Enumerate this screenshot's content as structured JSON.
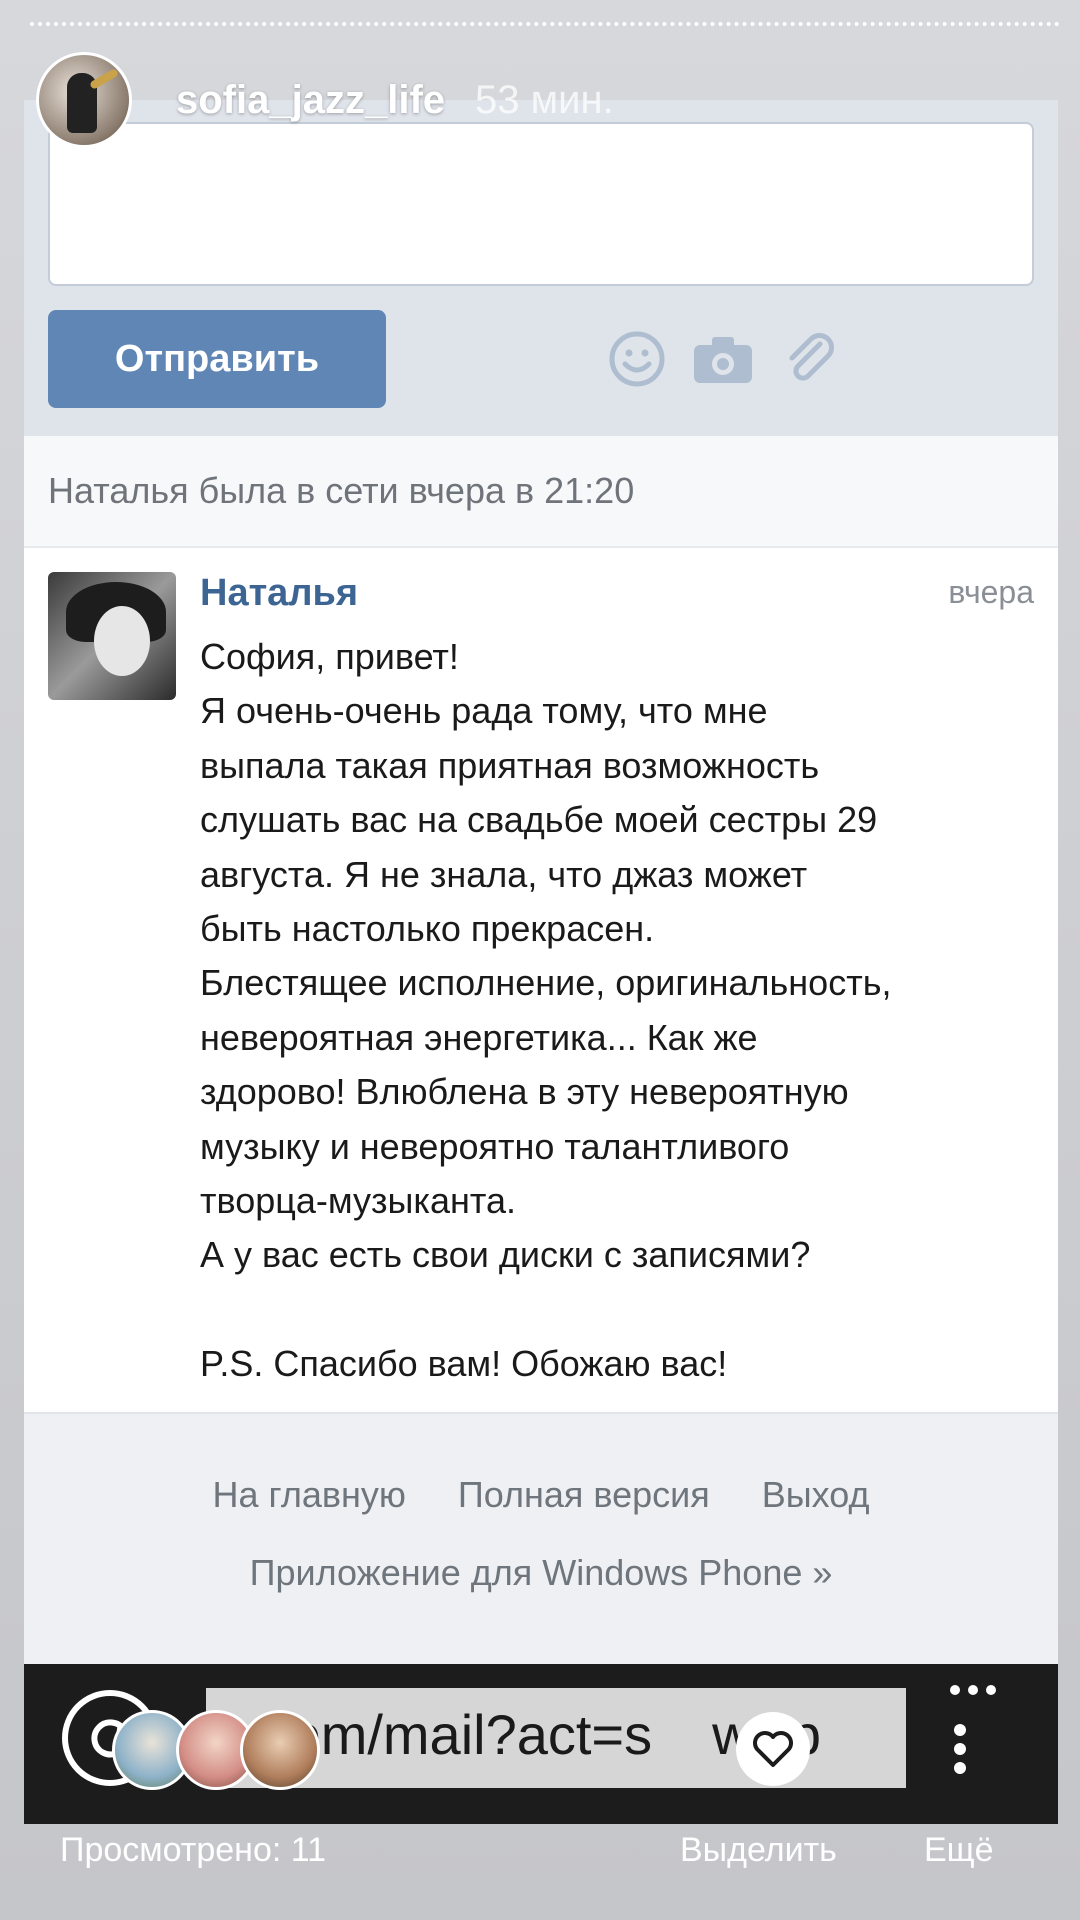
{
  "story": {
    "username": "sofia_jazz_life",
    "time_ago": "53 мин."
  },
  "compose": {
    "send_label": "Отправить",
    "icons": [
      "smile-icon",
      "camera-icon",
      "paperclip-icon"
    ]
  },
  "status": {
    "text": "Наталья была в сети вчера в 21:20"
  },
  "message": {
    "sender": "Наталья",
    "date": "вчера",
    "lines": [
      "София, привет!",
      "Я очень-очень рада тому, что мне",
      "выпала такая приятная возможность",
      "слушать вас на свадьбе моей сестры 29",
      "августа. Я не знала, что джаз может",
      "быть настолько прекрасен.",
      "Блестящее исполнение, оригинальность,",
      "невероятная энергетика... Как же",
      "здорово! Влюблена в эту невероятную",
      "музыку и невероятно талантливого",
      "творца-музыканта.",
      "А у вас есть свои диски с записями?",
      "",
      "P.S. Спасибо вам! Обожаю вас!"
    ]
  },
  "footer": {
    "home": "На главную",
    "full_version": "Полная версия",
    "logout": "Выход",
    "app_link": "Приложение для Windows Phone »"
  },
  "browser": {
    "url_visible": "k.com/mail?act=s",
    "url_tail": "w&p"
  },
  "bottom": {
    "viewed": "Просмотрено: 11",
    "select": "Выделить",
    "more": "Ещё"
  },
  "colors": {
    "vk_blue": "#5f86b5",
    "sender_blue": "#3d6593",
    "browser_bar": "#1c1c1c"
  }
}
